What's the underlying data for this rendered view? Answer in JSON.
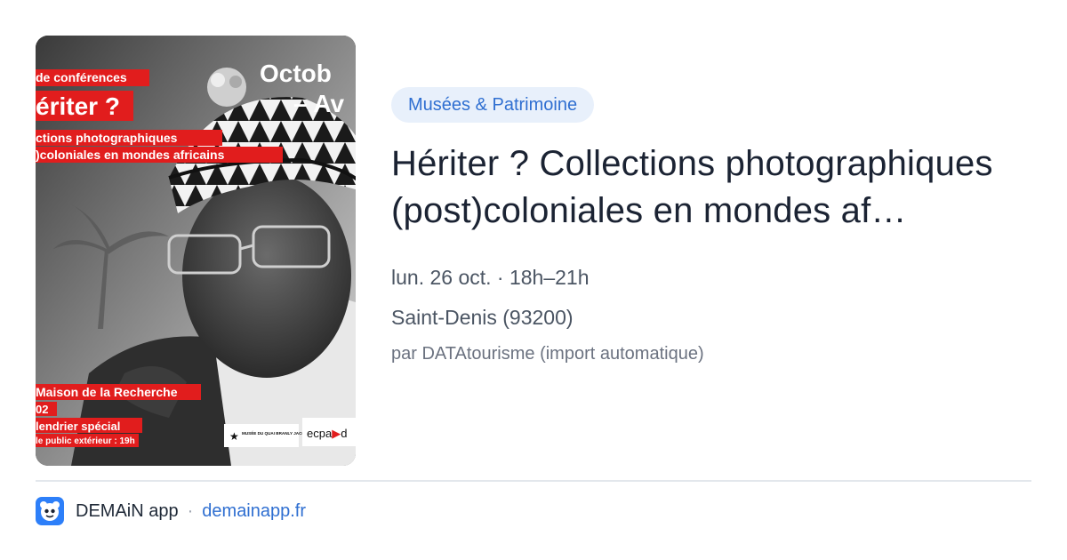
{
  "poster": {
    "series": "de conférences",
    "title": "ériter ?",
    "subtitle_line1": "ctions photographiques",
    "subtitle_line2": ")coloniales en mondes africains",
    "dates_line1": "Octob",
    "dates_line2": "– Av",
    "venue_line1": "Maison de la Recherche",
    "venue_line2": "02",
    "venue_line3": "lendrier spécial",
    "venue_line4": "le public extérieur : 19h",
    "logo1": "MUSÉE DU QUAI BRANLY JACQUES CHIRAC",
    "logo2": "ecpa",
    "logo2_suffix": "d",
    "accent_color": "#e11d1d"
  },
  "event": {
    "category": "Musées & Patrimoine",
    "title": "Hériter ? Collections photographiques (post)coloniales en mondes af…",
    "date": "lun. 26 oct. · 18h–21h",
    "location": "Saint-Denis (93200)",
    "source": "par DATAtourisme (import automatique)"
  },
  "footer": {
    "app_name": "DEMAiN app",
    "separator": "·",
    "url": "demainapp.fr",
    "logo_icon": "app-mascot-icon",
    "logo_color": "#2d7ff9"
  }
}
